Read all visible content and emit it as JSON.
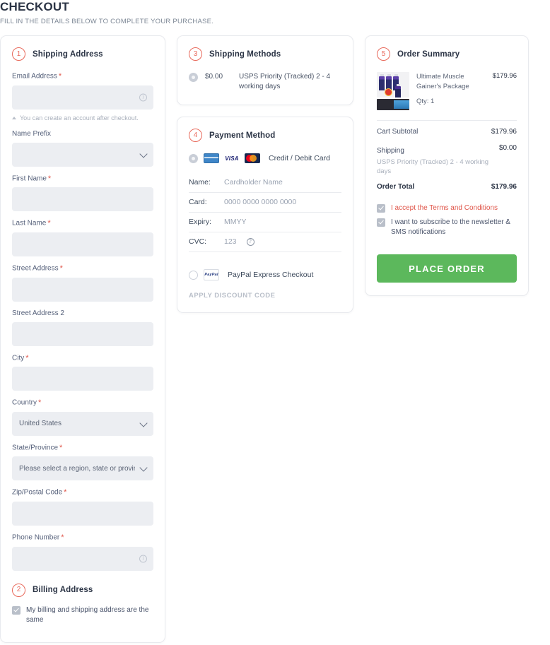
{
  "page": {
    "title": "CHECKOUT",
    "subtitle": "FILL IN THE DETAILS BELOW TO COMPLETE YOUR PURCHASE."
  },
  "colors": {
    "accent": "#e8685a",
    "link": "#e0574b",
    "place_order": "#5cb85c",
    "field_bg": "#eceef2"
  },
  "shipping_address": {
    "step": "1",
    "title": "Shipping Address",
    "email": {
      "label": "Email Address",
      "required": true,
      "value": "",
      "placeholder": "",
      "hint": "You can create an account after checkout.",
      "info_icon": "info-icon"
    },
    "name_prefix": {
      "label": "Name Prefix",
      "required": false,
      "value": "",
      "placeholder": ""
    },
    "first_name": {
      "label": "First Name",
      "required": true,
      "value": "",
      "placeholder": ""
    },
    "last_name": {
      "label": "Last Name",
      "required": true,
      "value": "",
      "placeholder": ""
    },
    "street_address": {
      "label": "Street Address",
      "required": true,
      "value": "",
      "placeholder": ""
    },
    "street_address_2": {
      "label": "Street Address 2",
      "required": false,
      "value": "",
      "placeholder": ""
    },
    "city": {
      "label": "City",
      "required": true,
      "value": "",
      "placeholder": ""
    },
    "country": {
      "label": "Country",
      "required": true,
      "value": "United States"
    },
    "state": {
      "label": "State/Province",
      "required": true,
      "value": "Please select a region, state or province."
    },
    "zip": {
      "label": "Zip/Postal Code",
      "required": true,
      "value": "",
      "placeholder": ""
    },
    "phone": {
      "label": "Phone Number",
      "required": true,
      "value": "",
      "placeholder": "",
      "info_icon": "info-icon"
    }
  },
  "billing_address": {
    "step": "2",
    "title": "Billing Address",
    "same_as_shipping_label": "My billing and shipping address are the same",
    "same_as_shipping_checked": true
  },
  "shipping_methods": {
    "step": "3",
    "title": "Shipping Methods",
    "options": [
      {
        "selected": true,
        "price": "$0.00",
        "description": "USPS Priority (Tracked) 2 - 4 working days"
      }
    ]
  },
  "payment_method": {
    "step": "4",
    "title": "Payment Method",
    "credit_card": {
      "selected": true,
      "label": "Credit / Debit Card",
      "icons": [
        "generic-card-icon",
        "visa-icon",
        "mastercard-icon"
      ],
      "fields": [
        {
          "key": "Name:",
          "value": "Cardholder Name",
          "name": "cardholder-name-input"
        },
        {
          "key": "Card:",
          "value": "0000 0000 0000 0000",
          "name": "card-number-input"
        },
        {
          "key": "Expiry:",
          "value": "MMYY",
          "name": "card-expiry-input"
        },
        {
          "key": "CVC:",
          "value": "123",
          "name": "card-cvc-input",
          "help_icon": "question-icon"
        }
      ]
    },
    "paypal": {
      "selected": false,
      "label": "PayPal Express Checkout",
      "icon": "paypal-icon"
    },
    "discount_label": "APPLY DISCOUNT CODE"
  },
  "order_summary": {
    "step": "5",
    "title": "Order Summary",
    "product": {
      "name": "Ultimate Muscle Gainer's Package",
      "price": "$179.96",
      "qty_label": "Qty: 1",
      "thumbnail": "product-thumbnail"
    },
    "totals": [
      {
        "key": "Cart Subtotal",
        "value": "$179.96",
        "note": "",
        "is_total": false
      },
      {
        "key": "Shipping",
        "value": "$0.00",
        "note": "USPS Priority (Tracked) 2 - 4 working days",
        "is_total": false
      },
      {
        "key": "Order Total",
        "value": "$179.96",
        "note": "",
        "is_total": true
      }
    ],
    "terms": {
      "checked": true,
      "text": "I accept the Terms and Conditions"
    },
    "newsletter": {
      "checked": true,
      "text": "I want to subscribe to the newsletter & SMS notifications"
    },
    "place_order_label": "PLACE ORDER"
  }
}
